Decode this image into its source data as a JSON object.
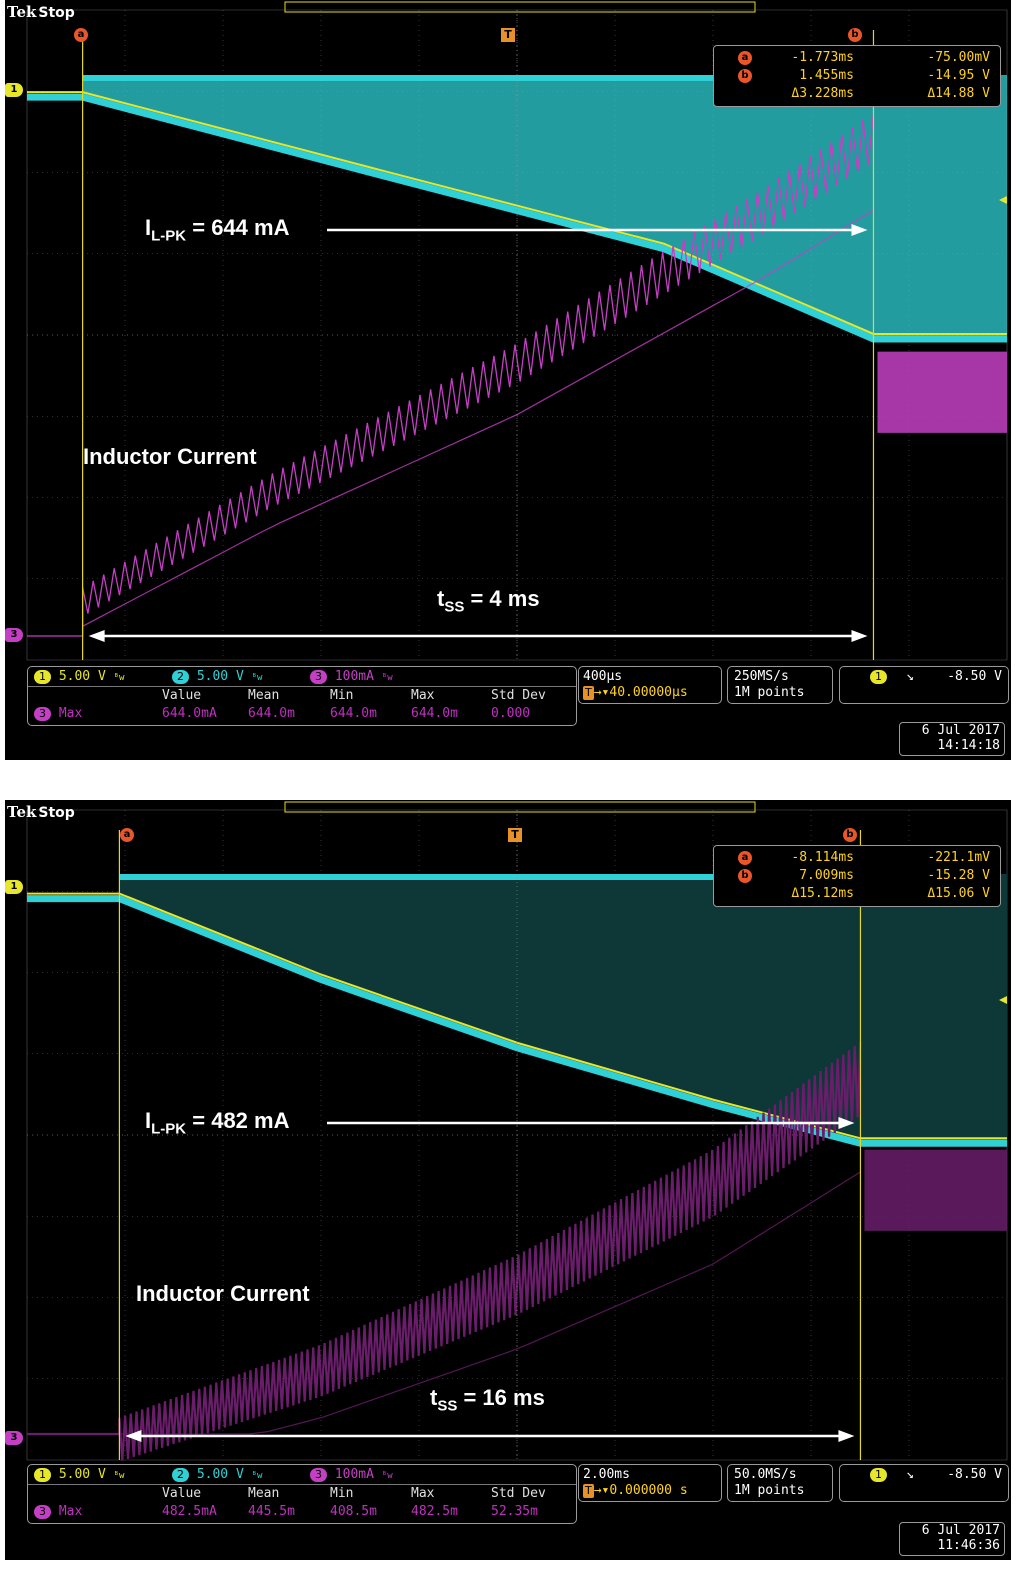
{
  "brand": "Tek",
  "acq_state": "Stop",
  "colors": {
    "ch1": "#e6e62a",
    "ch2": "#2fd0d6",
    "ch3": "#c43fc4",
    "cursor": "#e6d820",
    "graticule": "#5a5a5a",
    "badge_cursor": "#e8562a"
  },
  "chart_data": [
    {
      "type": "line",
      "title": "",
      "xlabel": "",
      "ylabel": "",
      "time_per_div": "400µs",
      "x_divisions": 10,
      "x_unit": "ms",
      "xlim": [
        -2.0,
        2.0
      ],
      "trigger_position": "40.00000µs",
      "sample_rate": "250MS/s",
      "record_length": "1M points",
      "series": [
        {
          "name": "1",
          "scale": "5.00 V",
          "x": [
            -2.0,
            -1.773,
            -0.6,
            0.6,
            1.455,
            2.0
          ],
          "y": [
            -0.07,
            -0.07,
            -4.7,
            -9.4,
            -14.95,
            -14.95
          ]
        },
        {
          "name": "2",
          "scale": "5.00 V",
          "x": [
            -2.0,
            -1.773,
            1.455,
            2.0
          ],
          "y": [
            -0.07,
            0.8,
            0.8,
            -15.5
          ]
        },
        {
          "name": "3",
          "scale": "100mA",
          "x": [
            -2.0,
            -1.773,
            -1.0,
            0.0,
            1.0,
            1.455,
            1.5,
            2.0
          ],
          "y": [
            0.0,
            0.06,
            0.2,
            0.36,
            0.55,
            0.644,
            0.3,
            0.3
          ]
        }
      ],
      "cursors": {
        "a": {
          "time": "-1.773ms",
          "value": "-75.00mV"
        },
        "b": {
          "time": "1.455ms",
          "value": "-14.95 V"
        },
        "delta": {
          "time": "Δ3.228ms",
          "value": "Δ14.88 V"
        }
      },
      "annotations": {
        "peak_label": "I",
        "peak_sub": "L-PK",
        "peak_value": "= 644 mA",
        "trace_label": "Inductor Current",
        "tss_label": "t",
        "tss_sub": "SS",
        "tss_value": "= 4 ms"
      },
      "channels": [
        {
          "num": "1",
          "scale": "5.00 V"
        },
        {
          "num": "2",
          "scale": "5.00 V"
        },
        {
          "num": "3",
          "scale": "100mA"
        }
      ],
      "bw_mark": "ᴮw",
      "measurement": {
        "channel": "3",
        "type": "Max",
        "headers": [
          "Value",
          "Mean",
          "Min",
          "Max",
          "Std Dev"
        ],
        "values": [
          "644.0mA",
          "644.0m",
          "644.0m",
          "644.0m",
          "0.000"
        ]
      },
      "trigger": {
        "channel": "1",
        "slope": "↘",
        "level": "-8.50 V"
      },
      "date": "6 Jul  2017",
      "time": "14:14:18"
    },
    {
      "type": "line",
      "title": "",
      "xlabel": "",
      "ylabel": "",
      "time_per_div": "2.00ms",
      "x_divisions": 10,
      "x_unit": "ms",
      "xlim": [
        -10.0,
        10.0
      ],
      "trigger_position": "0.000000 s",
      "sample_rate": "50.0MS/s",
      "record_length": "1M points",
      "series": [
        {
          "name": "1",
          "scale": "5.00 V",
          "x": [
            -10.0,
            -8.114,
            -4.0,
            0.0,
            4.0,
            7.009,
            10.0
          ],
          "y": [
            -0.22,
            -0.22,
            -5.2,
            -9.4,
            -12.9,
            -15.28,
            -15.28
          ]
        },
        {
          "name": "2",
          "scale": "5.00 V",
          "x": [
            -10.0,
            -8.114,
            7.009,
            10.0
          ],
          "y": [
            -0.22,
            0.8,
            0.8,
            -15.5
          ]
        },
        {
          "name": "3",
          "scale": "100mA",
          "x": [
            -10.0,
            -8.114,
            -4.0,
            0.0,
            4.0,
            7.009,
            7.2,
            10.0
          ],
          "y": [
            0.0,
            0.02,
            0.11,
            0.22,
            0.35,
            0.4825,
            0.3,
            0.3
          ]
        }
      ],
      "cursors": {
        "a": {
          "time": "-8.114ms",
          "value": "-221.1mV"
        },
        "b": {
          "time": "7.009ms",
          "value": "-15.28 V"
        },
        "delta": {
          "time": "Δ15.12ms",
          "value": "Δ15.06 V"
        }
      },
      "annotations": {
        "peak_label": "I",
        "peak_sub": "L-PK",
        "peak_value": "= 482 mA",
        "trace_label": "Inductor Current",
        "tss_label": "t",
        "tss_sub": "SS",
        "tss_value": "= 16 ms"
      },
      "channels": [
        {
          "num": "1",
          "scale": "5.00 V"
        },
        {
          "num": "2",
          "scale": "5.00 V"
        },
        {
          "num": "3",
          "scale": "100mA"
        }
      ],
      "bw_mark": "ᴮw",
      "measurement": {
        "channel": "3",
        "type": "Max",
        "headers": [
          "Value",
          "Mean",
          "Min",
          "Max",
          "Std Dev"
        ],
        "values": [
          "482.5mA",
          "445.5m",
          "408.5m",
          "482.5m",
          "52.35m"
        ]
      },
      "trigger": {
        "channel": "1",
        "slope": "↘",
        "level": "-8.50 V"
      },
      "date": "6 Jul  2017",
      "time": "11:46:36"
    }
  ]
}
